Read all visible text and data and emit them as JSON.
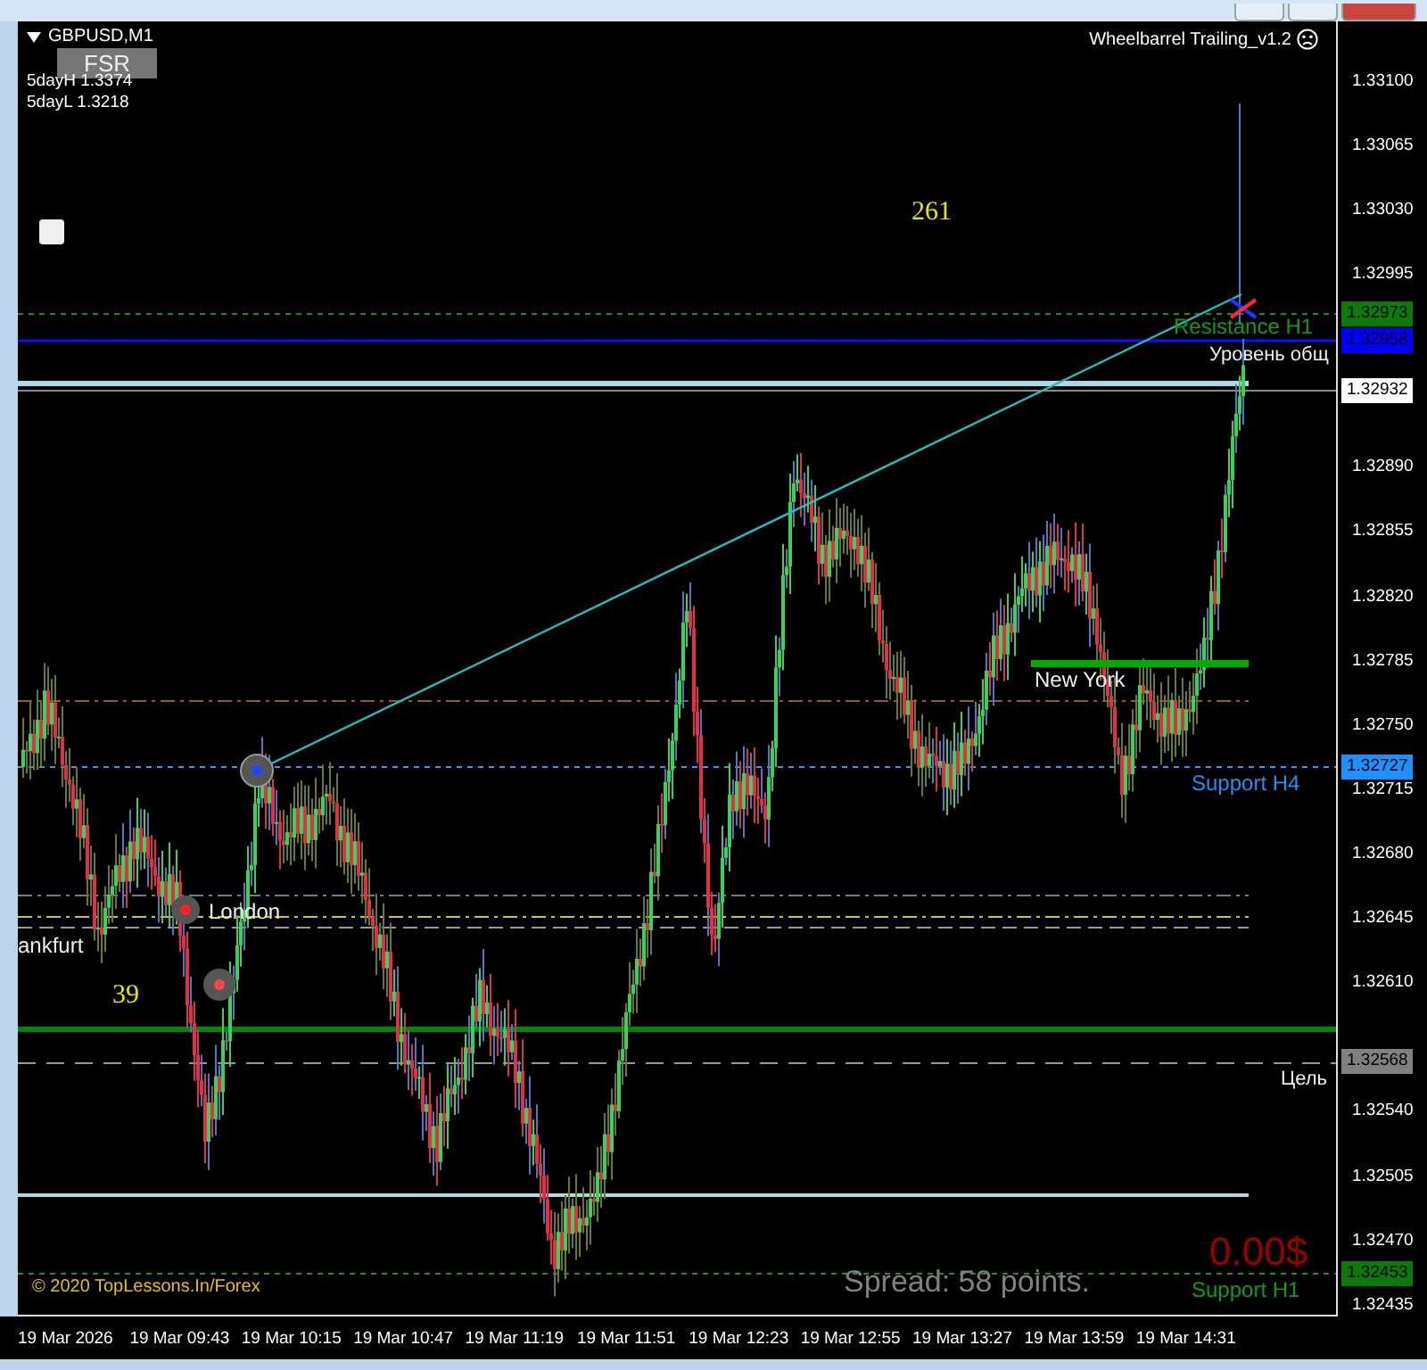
{
  "chart": {
    "symbol": "GBPUSD,M1",
    "fsr_button": "FSR",
    "checkbox": {
      "checked": false
    },
    "info_lines": [
      "5dayH 1.3374",
      "5dayL 1.3218"
    ],
    "expert": "Wheelbarrel Trailing_v1.2",
    "annotations": [
      {
        "text": "261",
        "kind": "count"
      },
      {
        "text": "Resistance H1",
        "kind": "level"
      },
      {
        "text": "Уровень общ",
        "kind": "level"
      },
      {
        "text": "New York",
        "kind": "session"
      },
      {
        "text": "Support H4",
        "kind": "level"
      },
      {
        "text": "London",
        "kind": "session"
      },
      {
        "text": "ankfurt",
        "kind": "session"
      },
      {
        "text": "39",
        "kind": "count"
      },
      {
        "text": "Цель",
        "kind": "level"
      },
      {
        "text": "Support H1",
        "kind": "level"
      }
    ],
    "copyright": "© 2020 TopLessons.In/Forex",
    "spread": "Spread: 58 points.",
    "profit": "0.00$"
  },
  "price_axis": {
    "ticks": [
      "1.33100",
      "1.33065",
      "1.33030",
      "1.32995",
      "1.32890",
      "1.32855",
      "1.32820",
      "1.32785",
      "1.32750",
      "1.32715",
      "1.32680",
      "1.32645",
      "1.32610",
      "1.32540",
      "1.32505",
      "1.32470",
      "1.32435"
    ],
    "markers": [
      {
        "text": "1.32973",
        "color": "#0a7a0a"
      },
      {
        "text": "1.32958",
        "color": "#0000ff"
      },
      {
        "text": "1.32932",
        "color": "#ffffff"
      },
      {
        "text": "1.32727",
        "color": "#1e90ff"
      },
      {
        "text": "1.32568",
        "color": "#808080"
      },
      {
        "text": "1.32453",
        "color": "#0a7a0a"
      }
    ]
  },
  "time_axis": [
    "19 Mar 2026",
    "19 Mar 09:43",
    "19 Mar 10:15",
    "19 Mar 10:47",
    "19 Mar 11:19",
    "19 Mar 11:51",
    "19 Mar 12:23",
    "19 Mar 12:55",
    "19 Mar 13:27",
    "19 Mar 13:59",
    "19 Mar 14:31"
  ]
}
